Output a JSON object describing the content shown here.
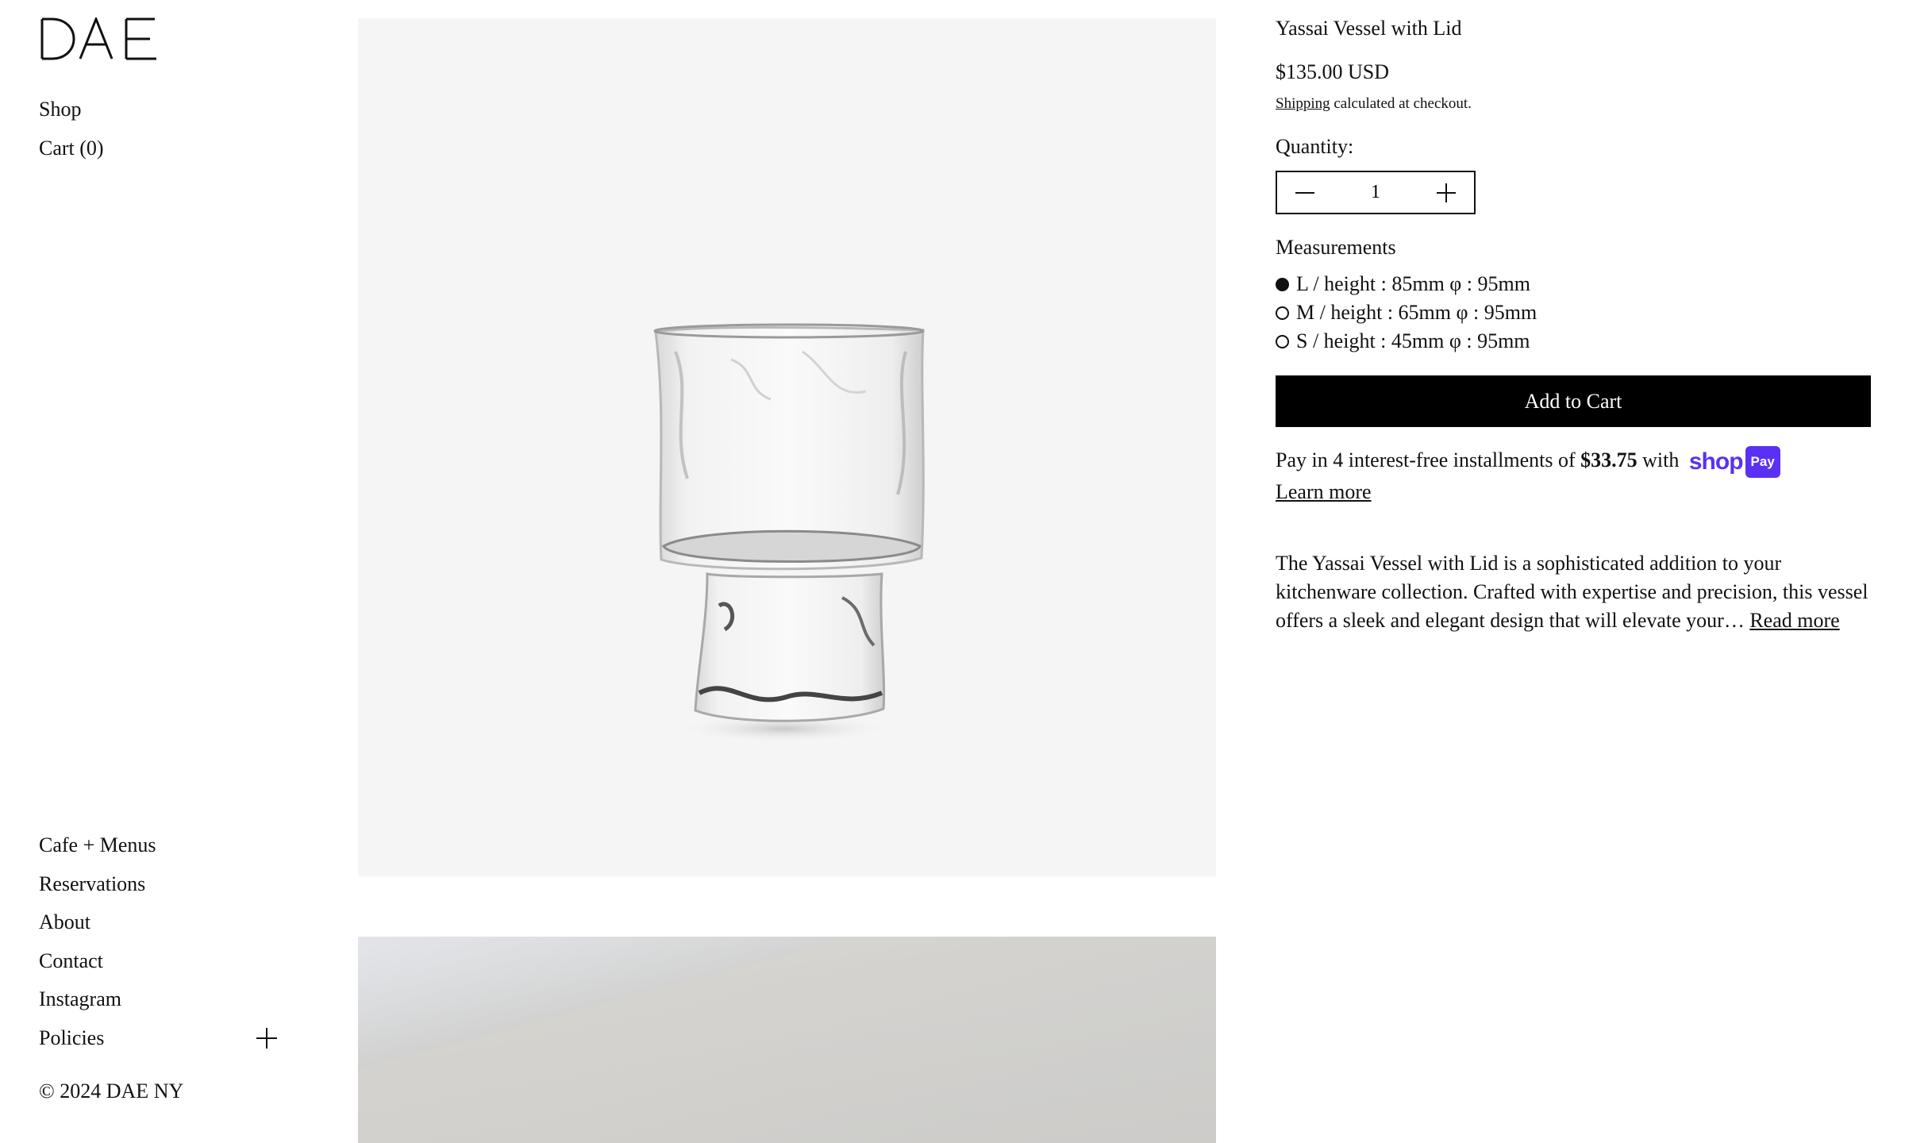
{
  "brand": {
    "logo_text": "DAE"
  },
  "nav_top": [
    {
      "label": "Shop"
    },
    {
      "label": "Cart (0)"
    }
  ],
  "nav_bottom": [
    {
      "label": "Cafe + Menus"
    },
    {
      "label": "Reservations"
    },
    {
      "label": "About"
    },
    {
      "label": "Contact"
    },
    {
      "label": "Instagram"
    },
    {
      "label": "Policies"
    }
  ],
  "footer": {
    "copyright": "© 2024 DAE NY"
  },
  "product": {
    "title": "Yassai Vessel with Lid",
    "price": "$135.00 USD",
    "shipping_link": "Shipping",
    "shipping_text": " calculated at checkout.",
    "quantity_label": "Quantity:",
    "quantity_value": "1",
    "measurements_label": "Measurements",
    "options": [
      {
        "label": "L / height : 85mm φ : 95mm",
        "selected": true
      },
      {
        "label": "M / height : 65mm φ : 95mm",
        "selected": false
      },
      {
        "label": "S / height : 45mm φ : 95mm",
        "selected": false
      }
    ],
    "add_to_cart": "Add to Cart",
    "installments_prefix": "Pay in 4 interest-free installments of ",
    "installments_amount": "$33.75",
    "installments_suffix": " with",
    "shop_pay_word": "shop",
    "shop_pay_badge": "Pay",
    "learn_more": "Learn more",
    "description": "The Yassai Vessel with Lid is a sophisticated addition to your kitchenware collection. Crafted with expertise and precision, this vessel offers a sleek and elegant design that will elevate your…",
    "read_more": "Read more"
  },
  "colors": {
    "shop_pay": "#5a31f4",
    "button_bg": "#000000",
    "image_bg": "#f5f5f5"
  }
}
